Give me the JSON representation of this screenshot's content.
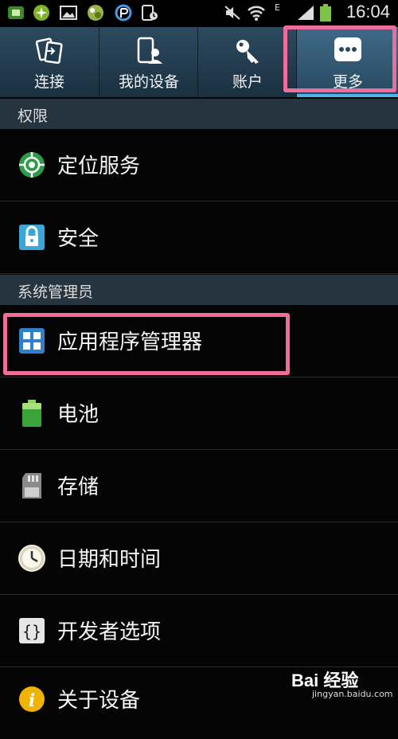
{
  "status_bar": {
    "time": "16:04",
    "network_label": "E",
    "icons": [
      "sim-icon",
      "game-icon",
      "image-icon",
      "app-icon",
      "refresh-app-icon",
      "screenshot-icon",
      "mute-icon",
      "wifi-icon",
      "signal-icon",
      "battery-icon"
    ]
  },
  "tabs": [
    {
      "label": "连接",
      "icon": "connection-icon"
    },
    {
      "label": "我的设备",
      "icon": "device-icon"
    },
    {
      "label": "账户",
      "icon": "key-icon"
    },
    {
      "label": "更多",
      "icon": "more-icon",
      "selected": true
    }
  ],
  "sections": [
    {
      "title": "权限",
      "items": [
        {
          "label": "定位服务",
          "icon": "location-icon"
        },
        {
          "label": "安全",
          "icon": "lock-icon"
        }
      ]
    },
    {
      "title": "系统管理员",
      "items": [
        {
          "label": "应用程序管理器",
          "icon": "app-grid-icon"
        },
        {
          "label": "电池",
          "icon": "battery-icon"
        },
        {
          "label": "存储",
          "icon": "sd-card-icon"
        },
        {
          "label": "日期和时间",
          "icon": "clock-icon"
        },
        {
          "label": "开发者选项",
          "icon": "braces-icon"
        },
        {
          "label": "关于设备",
          "icon": "info-icon"
        }
      ]
    }
  ],
  "highlight_color": "#f06c9a",
  "accent_color": "#4fb0ea",
  "watermark": {
    "logo": "Bai 经验",
    "url": "jingyan.baidu.com"
  }
}
